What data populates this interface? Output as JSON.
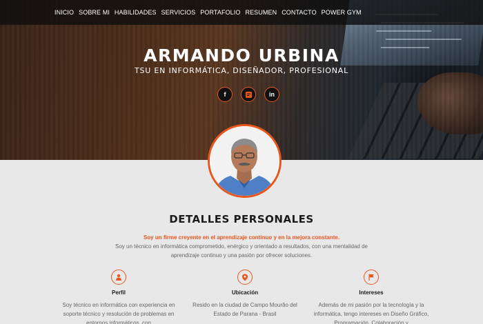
{
  "nav": {
    "items": [
      "INICIO",
      "SOBRE MI",
      "HABILIDADES",
      "SERVICIOS",
      "PORTAFOLIO",
      "RESUMEN",
      "CONTACTO",
      "POWER GYM"
    ]
  },
  "hero": {
    "name": "ARMANDO URBINA",
    "subtitle": "TSU EN INFORMÁTICA, DISEÑADOR, PROFESIONAL",
    "social": [
      {
        "icon": "facebook-icon",
        "glyph": "f"
      },
      {
        "icon": "blog-icon",
        "glyph": ""
      },
      {
        "icon": "linkedin-icon",
        "glyph": "in"
      }
    ]
  },
  "section": {
    "title": "DETALLES PERSONALES",
    "highlight": "Soy un firme creyente en el aprendizaje continuo y en la mejora constante.",
    "description": "Soy un técnico en informática comprometido, enérgico y orientado a resultados, con una mentalidad de aprendizaje continuo y una pasión por ofrecer soluciones."
  },
  "features": [
    {
      "icon": "user-icon",
      "title": "Perfil",
      "text": "Soy técnico en informática con experiencia en soporte técnico y resolución de problemas en entornos informáticos, con"
    },
    {
      "icon": "location-pin-icon",
      "title": "Ubicación",
      "text": "Resido en la ciudad de Campo Mourão del Estado de Parana - Brasil"
    },
    {
      "icon": "flag-icon",
      "title": "Intereses",
      "text": "Además de mi pasión por la tecnología y la informática, tengo intereses en Diseño Gráfico, Programación, Colaboración y"
    }
  ],
  "colors": {
    "accent": "#e8561e",
    "nav_bg": "#0f0f0f",
    "section_bg": "#e8e8e8"
  }
}
